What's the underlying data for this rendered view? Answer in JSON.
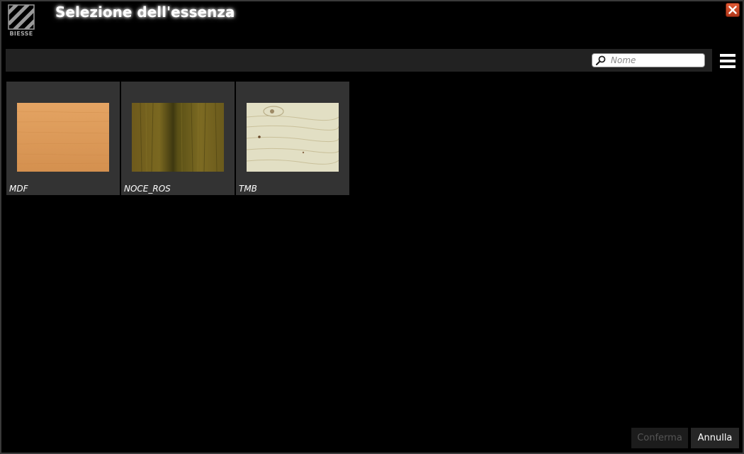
{
  "window": {
    "title": "Selezione dell'essenza",
    "logo_text": "BIESSE"
  },
  "search": {
    "placeholder": "Nome",
    "value": ""
  },
  "icons": {
    "close": "close-icon",
    "search": "search-icon",
    "menu": "hamburger-menu-icon"
  },
  "colors": {
    "accent_close": "#c9442a",
    "tile_bg": "#333333",
    "toolbar_bg": "#222222"
  },
  "materials": [
    {
      "label": "MDF"
    },
    {
      "label": "NOCE_ROS"
    },
    {
      "label": "TMB"
    }
  ],
  "footer": {
    "confirm_label": "Conferma",
    "cancel_label": "Annulla"
  }
}
